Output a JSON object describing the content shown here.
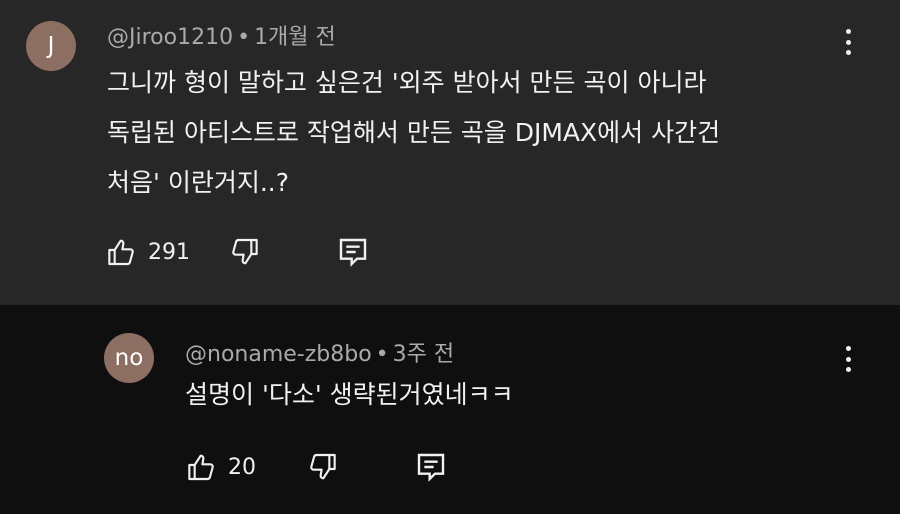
{
  "comments": [
    {
      "avatar_letter": "J",
      "avatar_color": "#8d6e63",
      "author": "@Jiroo1210",
      "separator": "•",
      "time": "1개월 전",
      "lines": [
        "그니까 형이 말하고 싶은건 '외주 받아서 만든 곡이 아니라",
        "독립된 아티스트로 작업해서 만든 곡을 DJMAX에서 사간건",
        "처음' 이란거지..?"
      ],
      "likes": "291",
      "icons": {
        "like": "thumb-up-icon",
        "dislike": "thumb-down-icon",
        "reply": "reply-icon",
        "menu": "more-vert-icon"
      }
    },
    {
      "avatar_letter": "no",
      "avatar_color": "#8d6e63",
      "author": "@noname-zb8bo",
      "separator": "•",
      "time": "3주 전",
      "lines": [
        "설명이 '다소' 생략된거였네ㅋㅋ"
      ],
      "likes": "20",
      "icons": {
        "like": "thumb-up-icon",
        "dislike": "thumb-down-icon",
        "reply": "reply-icon",
        "menu": "more-vert-icon"
      }
    }
  ],
  "colors": {
    "top_comment_bg": "#272727",
    "reply_bg": "#0f0f0f",
    "text_primary": "#f1f1f1",
    "text_secondary": "#aaaaaa"
  }
}
